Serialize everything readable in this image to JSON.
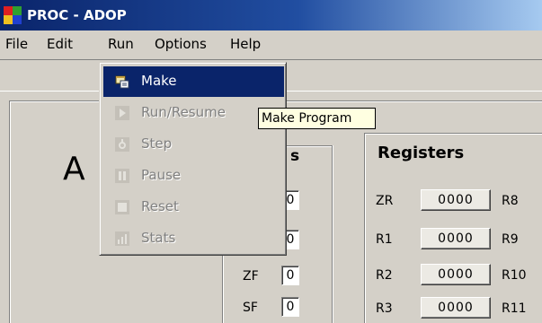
{
  "window": {
    "title": "PROC - ADOP",
    "icon": "app-logo-icon"
  },
  "menubar": {
    "items": [
      {
        "label": "File"
      },
      {
        "label": "Edit"
      },
      {
        "label": "Run",
        "open": true
      },
      {
        "label": "Options"
      },
      {
        "label": "Help"
      }
    ]
  },
  "run_menu": {
    "items": [
      {
        "label": "Make",
        "icon": "make-icon",
        "enabled": true,
        "highlighted": true
      },
      {
        "label": "Run/Resume",
        "icon": "play-icon",
        "enabled": false
      },
      {
        "label": "Step",
        "icon": "step-icon",
        "enabled": false
      },
      {
        "label": "Pause",
        "icon": "pause-icon",
        "enabled": false
      },
      {
        "label": "Reset",
        "icon": "reset-icon",
        "enabled": false
      },
      {
        "label": "Stats",
        "icon": "stats-icon",
        "enabled": false
      }
    ]
  },
  "tooltip": {
    "text": "Make Program"
  },
  "main": {
    "big_letter": "A"
  },
  "flags": {
    "title_fragment": "s",
    "items": [
      {
        "label": "",
        "value": "0"
      },
      {
        "label": "",
        "value": "0"
      },
      {
        "label": "ZF",
        "value": "0"
      },
      {
        "label": "SF",
        "value": "0"
      }
    ]
  },
  "registers": {
    "title": "Registers",
    "rows": [
      {
        "name": "ZR",
        "value": "0000",
        "pair": "R8"
      },
      {
        "name": "R1",
        "value": "0000",
        "pair": "R9"
      },
      {
        "name": "R2",
        "value": "0000",
        "pair": "R10"
      },
      {
        "name": "R3",
        "value": "0000",
        "pair": "R11"
      }
    ]
  },
  "colors": {
    "titlebar_start": "#0a246a",
    "titlebar_end": "#a6caf0",
    "menu_highlight": "#0a246a",
    "face": "#d4d0c8",
    "tooltip_bg": "#ffffe1"
  }
}
